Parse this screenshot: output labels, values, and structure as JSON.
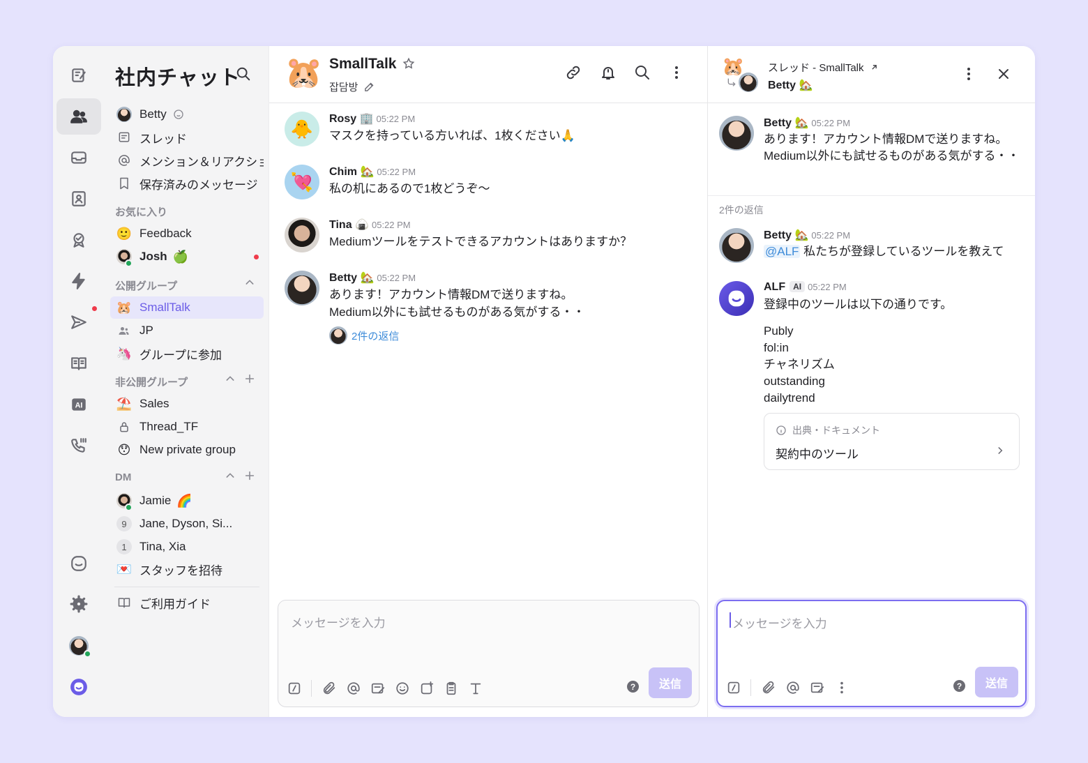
{
  "workspace": {
    "title": "社内チャット"
  },
  "sidebar": {
    "top_items": [
      {
        "label": "Betty",
        "icon": "user-avatar"
      },
      {
        "label": "スレッド",
        "icon": "thread-icon"
      },
      {
        "label": "メンション＆リアクション",
        "icon": "at-icon"
      },
      {
        "label": "保存済みのメッセージ",
        "icon": "bookmark-icon"
      }
    ],
    "favorites_header": "お気に入り",
    "favorites": [
      {
        "label": "Feedback",
        "emoji": "🙂"
      },
      {
        "label": "Josh",
        "emoji": "🍏"
      }
    ],
    "public_header": "公開グループ",
    "public_groups": [
      {
        "label": "SmallTalk",
        "emoji": "🐹",
        "selected": true
      },
      {
        "label": "JP"
      },
      {
        "label": "グループに参加",
        "emoji": "🦄"
      }
    ],
    "private_header": "非公開グループ",
    "private_groups": [
      {
        "label": "Sales",
        "emoji": "⛱️"
      },
      {
        "label": "Thread_TF"
      },
      {
        "label": "New private group",
        "emoji": "😯"
      }
    ],
    "dm_header": "DM",
    "dms": [
      {
        "label": "Jamie",
        "emoji": "🌈"
      },
      {
        "label": "Jane, Dyson, Si...",
        "count": "9"
      },
      {
        "label": "Tina, Xia",
        "count": "1"
      },
      {
        "label": "スタッフを招待",
        "emoji": "💌"
      }
    ],
    "guide": "ご利用ガイド"
  },
  "channel": {
    "name": "SmallTalk",
    "emoji": "🐹",
    "subtitle": "잡담방",
    "messages": [
      {
        "author": "Rosy",
        "badge": "🏢",
        "time": "05:22 PM",
        "text": "マスクを持っている方いれば、1枚ください🙏",
        "avatar": "🐥"
      },
      {
        "author": "Chim",
        "badge": "🏡",
        "time": "05:22 PM",
        "text": "私の机にあるので1枚どうぞ～",
        "avatar": "💘"
      },
      {
        "author": "Tina",
        "badge": "🍙",
        "time": "05:22 PM",
        "text": "Mediumツールをテストできるアカウントはありますか？"
      },
      {
        "author": "Betty",
        "badge": "🏡",
        "time": "05:22 PM",
        "text_line1": "あります！アカウント情報DMで送りますね。",
        "text_line2": "Medium以外にも試せるものがある気がする・・",
        "replies": "2件の返信"
      }
    ],
    "composer_placeholder": "メッセージを入力",
    "send_label": "送信",
    "help": "?"
  },
  "thread": {
    "title": "スレッド - SmallTalk",
    "user": "Betty",
    "user_badge": "🏡",
    "parent": {
      "author": "Betty",
      "badge": "🏡",
      "time": "05:22 PM",
      "text_line1": "あります！アカウント情報DMで送りますね。",
      "text_line2": "Medium以外にも試せるものがある気がする・・"
    },
    "reply_count": "2件の返信",
    "reply1": {
      "author": "Betty",
      "badge": "🏡",
      "time": "05:22 PM",
      "mention": "@ALF",
      "text": "私たちが登録しているツールを教えて"
    },
    "reply2": {
      "author": "ALF",
      "ai_badge": "AI",
      "time": "05:22 PM",
      "text": "登録中のツールは以下の通りです。",
      "tools": [
        "Publy",
        "fol:in",
        "チャネリズム",
        "outstanding",
        "dailytrend"
      ]
    },
    "doc": {
      "label": "出典・ドキュメント",
      "title": "契約中のツール"
    },
    "composer_placeholder": "メッセージを入力",
    "send_label": "送信",
    "help": "?"
  },
  "colors": {
    "accent": "#6b5ce7",
    "page_bg": "#e5e3fd",
    "send_disabled": "#c8c2f7",
    "link": "#3d8bd9"
  }
}
